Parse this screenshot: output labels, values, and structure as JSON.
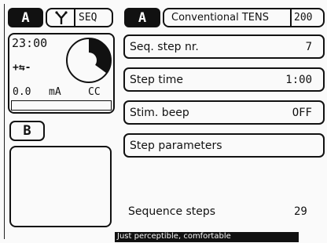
{
  "left_panel": {
    "channel_a_label": "A",
    "mode_icon": "y-split-icon",
    "mode_label": "SEQ",
    "timer": "23:00",
    "polarity": "+⇆-",
    "progress_fraction": 0.35,
    "current_value": "0.0",
    "current_unit": "mA",
    "current_mode": "CC",
    "channel_b_label": "B"
  },
  "right_panel": {
    "channel_label": "A",
    "program_name": "Conventional TENS",
    "program_number": "200",
    "rows": [
      {
        "label": "Seq. step nr.",
        "value": "7"
      },
      {
        "label": "Step time",
        "value": "1:00"
      },
      {
        "label": "Stim. beep",
        "value": "OFF"
      },
      {
        "label": "Step parameters",
        "value": ""
      }
    ],
    "sequence_steps_label": "Sequence steps",
    "sequence_steps_value": "29"
  },
  "status_bar": {
    "text": "Just perceptible, comfortable"
  }
}
